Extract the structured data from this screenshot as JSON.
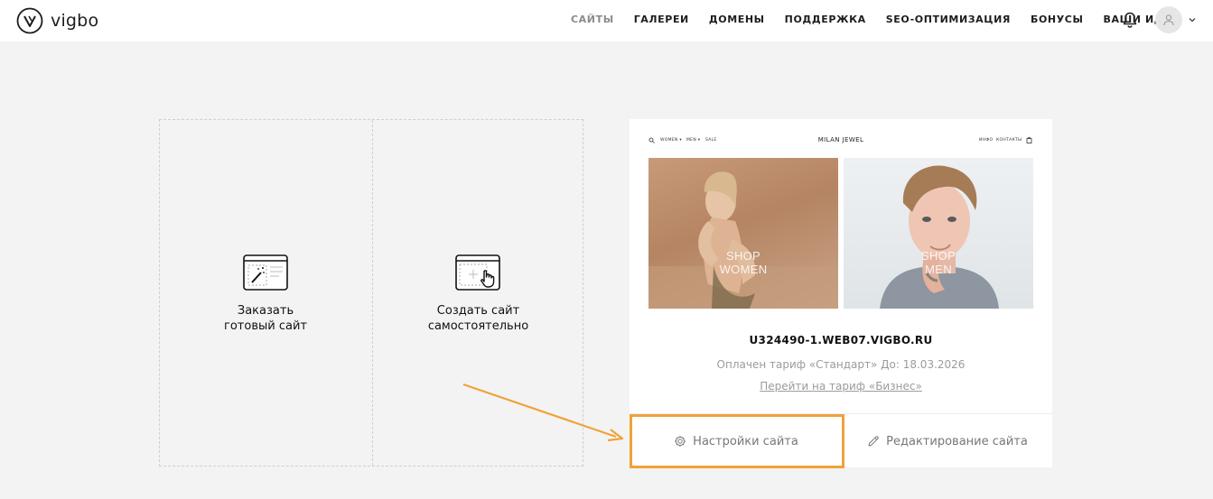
{
  "header": {
    "logo_text": "vigbo",
    "nav": [
      {
        "label": "САЙТЫ",
        "active": true
      },
      {
        "label": "ГАЛЕРЕИ",
        "active": false
      },
      {
        "label": "ДОМЕНЫ",
        "active": false
      },
      {
        "label": "ПОДДЕРЖКА",
        "active": false
      },
      {
        "label": "SEO-ОПТИМИЗАЦИЯ",
        "active": false
      },
      {
        "label": "БОНУСЫ",
        "active": false
      },
      {
        "label": "ВАШИ ИДЕИ",
        "active": false
      }
    ],
    "icons": {
      "bell": "bell-icon",
      "avatar": "user-icon",
      "menu": "chevron-down-icon"
    }
  },
  "create": {
    "order_label": "Заказать\nготовый сайт",
    "self_label": "Создать сайт\nсамостоятельно"
  },
  "site": {
    "preview": {
      "brand": "MILAN  JEWEL",
      "nav_left": [
        "WOMEN ▾",
        "MEN ▾",
        "SALE"
      ],
      "nav_right": [
        "ИНФО",
        "КОНТАКТЫ"
      ],
      "women_label": "SHOP\nWOMEN",
      "men_label": "SHOP\nMEN"
    },
    "domain": "U324490-1.WEB07.VIGBO.RU",
    "tariff": "Оплачен тариф «Стандарт» До: 18.03.2026",
    "upgrade_link": "Перейти на тариф «Бизнес»",
    "settings_label": "Настройки сайта",
    "edit_label": "Редактирование сайта"
  },
  "colors": {
    "accent_annotation": "#f0a23a",
    "background": "#f3f3f3",
    "muted_text": "#9b9b9b"
  }
}
